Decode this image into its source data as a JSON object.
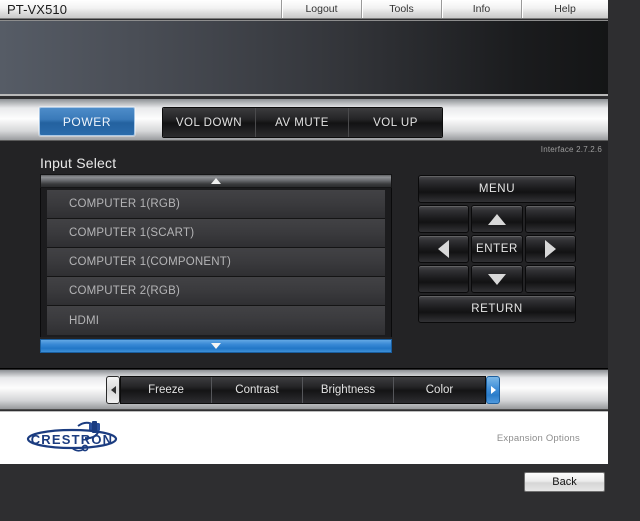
{
  "topbar": {
    "model": "PT-VX510",
    "nav": [
      {
        "label": "Logout"
      },
      {
        "label": "Tools"
      },
      {
        "label": "Info"
      },
      {
        "label": "Help"
      }
    ]
  },
  "function_bar": {
    "power_label": "POWER",
    "buttons": [
      {
        "label": "VOL DOWN"
      },
      {
        "label": "AV MUTE"
      },
      {
        "label": "VOL UP"
      }
    ]
  },
  "main": {
    "interface_version": "Interface 2.7.2.6",
    "title": "Input Select",
    "scroll_up_icon": "triangle-up-icon",
    "scroll_down_icon": "triangle-down-icon",
    "input_items": [
      {
        "label": "COMPUTER 1(RGB)"
      },
      {
        "label": "COMPUTER 1(SCART)"
      },
      {
        "label": "COMPUTER 1(COMPONENT)"
      },
      {
        "label": "COMPUTER 2(RGB)"
      },
      {
        "label": "HDMI"
      }
    ]
  },
  "remote": {
    "menu_label": "MENU",
    "enter_label": "ENTER",
    "return_label": "RETURN",
    "up_icon": "arrow-up-icon",
    "down_icon": "arrow-down-icon",
    "left_icon": "arrow-left-icon",
    "right_icon": "arrow-right-icon"
  },
  "sub_toolbar": {
    "prev_icon": "chevron-left-icon",
    "next_icon": "chevron-right-icon",
    "buttons": [
      {
        "label": "Freeze"
      },
      {
        "label": "Contrast"
      },
      {
        "label": "Brightness"
      },
      {
        "label": "Color"
      }
    ]
  },
  "footer": {
    "brand": "CRESTRON",
    "expansion_label": "Expansion Options"
  },
  "back_button": {
    "label": "Back"
  },
  "colors": {
    "accent_blue": "#2a7cc9",
    "panel_dark": "#232325",
    "list_item": "#3a3a3d",
    "page_bg": "#2e2e30",
    "brand_blue": "#1b3c80"
  }
}
